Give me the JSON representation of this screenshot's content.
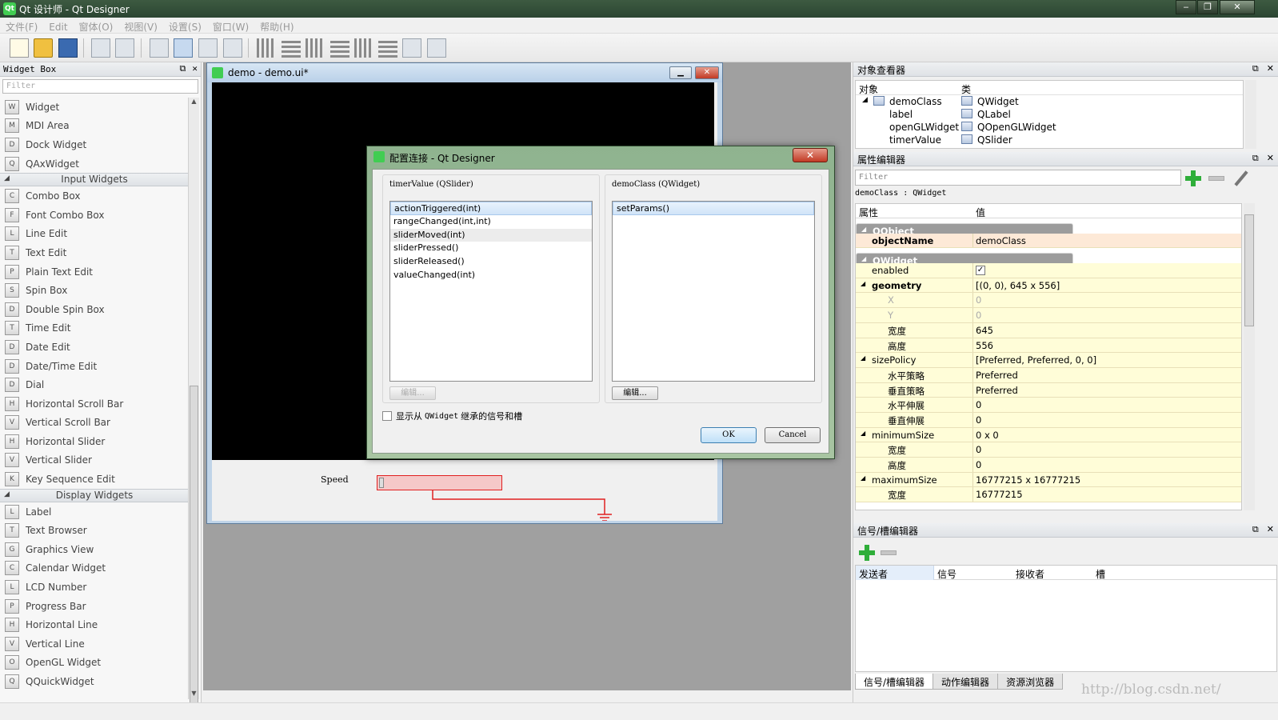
{
  "window": {
    "title": "Qt 设计师 - Qt Designer",
    "app_icon": "qt-logo-icon"
  },
  "menu": [
    "文件(F)",
    "Edit",
    "窗体(O)",
    "视图(V)",
    "设置(S)",
    "窗口(W)",
    "帮助(H)"
  ],
  "widget_box": {
    "title": "Widget Box",
    "filter_placeholder": "Filter",
    "groups": [
      {
        "name": "",
        "items": [
          {
            "label": "Widget",
            "icon": "widget-icon"
          },
          {
            "label": "MDI Area",
            "icon": "mdi-area-icon"
          },
          {
            "label": "Dock Widget",
            "icon": "dock-widget-icon"
          },
          {
            "label": "QAxWidget",
            "icon": "qaxwidget-icon"
          }
        ]
      },
      {
        "name": "Input Widgets",
        "items": [
          {
            "label": "Combo Box",
            "icon": "combo-box-icon"
          },
          {
            "label": "Font Combo Box",
            "icon": "font-combo-box-icon"
          },
          {
            "label": "Line Edit",
            "icon": "line-edit-icon"
          },
          {
            "label": "Text Edit",
            "icon": "text-edit-icon"
          },
          {
            "label": "Plain Text Edit",
            "icon": "plain-text-edit-icon"
          },
          {
            "label": "Spin Box",
            "icon": "spin-box-icon"
          },
          {
            "label": "Double Spin Box",
            "icon": "double-spin-box-icon"
          },
          {
            "label": "Time Edit",
            "icon": "time-edit-icon"
          },
          {
            "label": "Date Edit",
            "icon": "date-edit-icon"
          },
          {
            "label": "Date/Time Edit",
            "icon": "date-time-edit-icon"
          },
          {
            "label": "Dial",
            "icon": "dial-icon"
          },
          {
            "label": "Horizontal Scroll Bar",
            "icon": "horizontal-scroll-bar-icon"
          },
          {
            "label": "Vertical Scroll Bar",
            "icon": "vertical-scroll-bar-icon"
          },
          {
            "label": "Horizontal Slider",
            "icon": "horizontal-slider-icon"
          },
          {
            "label": "Vertical Slider",
            "icon": "vertical-slider-icon"
          },
          {
            "label": "Key Sequence Edit",
            "icon": "key-sequence-edit-icon"
          }
        ]
      },
      {
        "name": "Display Widgets",
        "items": [
          {
            "label": "Label",
            "icon": "label-icon"
          },
          {
            "label": "Text Browser",
            "icon": "text-browser-icon"
          },
          {
            "label": "Graphics View",
            "icon": "graphics-view-icon"
          },
          {
            "label": "Calendar Widget",
            "icon": "calendar-widget-icon"
          },
          {
            "label": "LCD Number",
            "icon": "lcd-number-icon"
          },
          {
            "label": "Progress Bar",
            "icon": "progress-bar-icon"
          },
          {
            "label": "Horizontal Line",
            "icon": "horizontal-line-icon"
          },
          {
            "label": "Vertical Line",
            "icon": "vertical-line-icon"
          },
          {
            "label": "OpenGL Widget",
            "icon": "opengl-widget-icon"
          },
          {
            "label": "QQuickWidget",
            "icon": "qquickwidget-icon"
          }
        ]
      }
    ]
  },
  "form_window": {
    "title": "demo - demo.ui*",
    "speed_label": "Speed"
  },
  "dialog": {
    "title": "配置连接 - Qt Designer",
    "left_group_title": "timerValue (QSlider)",
    "left_items": [
      "actionTriggered(int)",
      "rangeChanged(int,int)",
      "sliderMoved(int)",
      "sliderPressed()",
      "sliderReleased()",
      "valueChanged(int)"
    ],
    "left_edit": "编辑...",
    "right_group_title": "demoClass (QWidget)",
    "right_items": [
      "setParams()"
    ],
    "right_edit": "编辑...",
    "checkbox_pre": "显示从",
    "checkbox_mono": "QWidget",
    "checkbox_post": "继承的信号和槽",
    "ok": "OK",
    "cancel": "Cancel"
  },
  "object_inspector": {
    "title": "对象查看器",
    "col_object": "对象",
    "col_class": "类",
    "rows": [
      {
        "object": "demoClass",
        "class": "QWidget"
      },
      {
        "object": "label",
        "class": "QLabel"
      },
      {
        "object": "openGLWidget",
        "class": "QOpenGLWidget"
      },
      {
        "object": "timerValue",
        "class": "QSlider"
      }
    ]
  },
  "property_editor": {
    "title": "属性编辑器",
    "filter_placeholder": "Filter",
    "class_line": "demoClass : QWidget",
    "col_prop": "属性",
    "col_value": "值",
    "rows": [
      {
        "name": "QObject",
        "value": "",
        "kind": "group"
      },
      {
        "name": "objectName",
        "value": "demoClass",
        "kind": "org-bold"
      },
      {
        "name": "QWidget",
        "value": "",
        "kind": "group"
      },
      {
        "name": "enabled",
        "value": "✓",
        "kind": "check"
      },
      {
        "name": "geometry",
        "value": "[(0, 0), 645 x 556]",
        "kind": "bold-exp"
      },
      {
        "name": "X",
        "value": "0",
        "kind": "sub-dis"
      },
      {
        "name": "Y",
        "value": "0",
        "kind": "sub-dis"
      },
      {
        "name": "宽度",
        "value": "645",
        "kind": "sub"
      },
      {
        "name": "高度",
        "value": "556",
        "kind": "sub"
      },
      {
        "name": "sizePolicy",
        "value": "[Preferred, Preferred, 0, 0]",
        "kind": "exp"
      },
      {
        "name": "水平策略",
        "value": "Preferred",
        "kind": "sub"
      },
      {
        "name": "垂直策略",
        "value": "Preferred",
        "kind": "sub"
      },
      {
        "name": "水平伸展",
        "value": "0",
        "kind": "sub"
      },
      {
        "name": "垂直伸展",
        "value": "0",
        "kind": "sub"
      },
      {
        "name": "minimumSize",
        "value": "0 x 0",
        "kind": "exp"
      },
      {
        "name": "宽度",
        "value": "0",
        "kind": "sub"
      },
      {
        "name": "高度",
        "value": "0",
        "kind": "sub"
      },
      {
        "name": "maximumSize",
        "value": "16777215 x 16777215",
        "kind": "exp"
      },
      {
        "name": "宽度",
        "value": "16777215",
        "kind": "sub"
      }
    ]
  },
  "signal_slot_editor": {
    "title": "信号/槽编辑器",
    "cols": [
      "发送者",
      "信号",
      "接收者",
      "槽"
    ],
    "tabs": [
      "信号/槽编辑器",
      "动作编辑器",
      "资源浏览器"
    ]
  },
  "watermark": "http://blog.csdn.net/"
}
